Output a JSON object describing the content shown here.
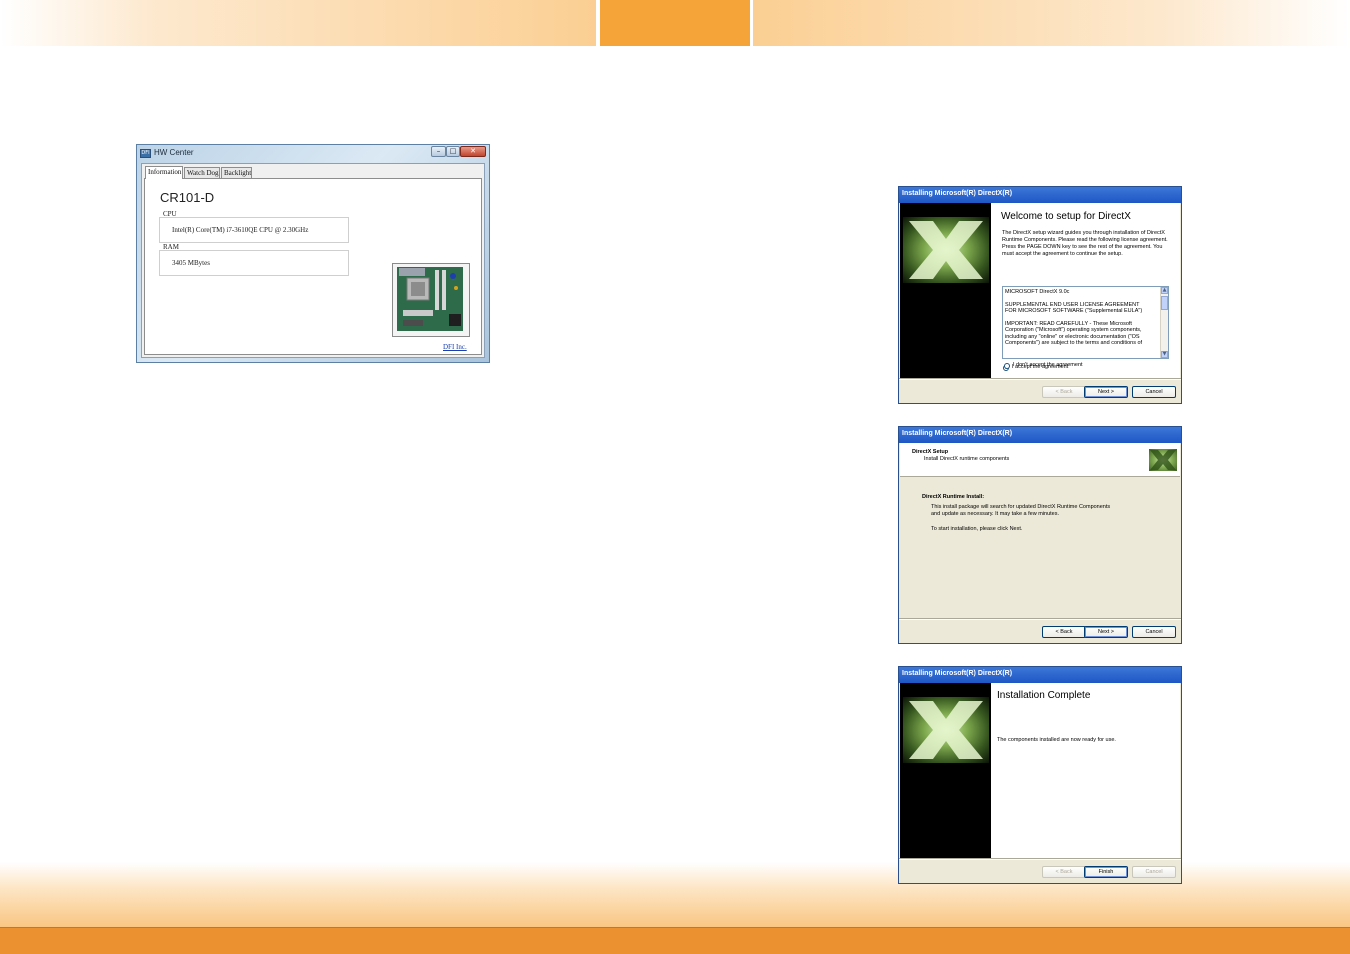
{
  "hw_center": {
    "title": "HW Center",
    "app_icon": "DFI",
    "tabs": [
      "Information",
      "Watch Dog",
      "Backlight"
    ],
    "model": "CR101-D",
    "cpu_label": "CPU",
    "cpu_value": "Intel(R) Core(TM) i7-3610QE CPU @ 2.30GHz",
    "ram_label": "RAM",
    "ram_value": "3405 MBytes",
    "board_image": "motherboard-photo",
    "link": "DFI Inc."
  },
  "directx_welcome": {
    "title": "Installing Microsoft(R) DirectX(R)",
    "heading": "Welcome to setup for DirectX",
    "intro": "The DirectX setup wizard guides you through installation of DirectX Runtime Components. Please read the following license agreement. Press the PAGE DOWN key to see the rest of the agreement. You must accept the agreement to continue the setup.",
    "license_lines": [
      "MICROSOFT DirectX 9.0c",
      "",
      "SUPPLEMENTAL END USER LICENSE AGREEMENT",
      "FOR MICROSOFT SOFTWARE (\"Supplemental EULA\")",
      "",
      "IMPORTANT: READ CAREFULLY - These Microsoft",
      "Corporation (\"Microsoft\") operating system components,",
      "including any \"online\" or electronic documentation (\"OS",
      "Components\") are subject to the terms and conditions of"
    ],
    "accept": "I accept the agreement",
    "decline": "I don't accept the agreement",
    "back": "< Back",
    "next": "Next >",
    "cancel": "Cancel"
  },
  "directx_setup": {
    "title": "Installing Microsoft(R) DirectX(R)",
    "header_title": "DirectX Setup",
    "header_sub": "Install DirectX runtime components",
    "section_title": "DirectX Runtime Install:",
    "line1": "This install package will search for updated DirectX Runtime Components",
    "line2": "and update as necessary. It may take a few minutes.",
    "line3": "To start installation, please click Next.",
    "back": "< Back",
    "next": "Next >",
    "cancel": "Cancel"
  },
  "directx_complete": {
    "title": "Installing Microsoft(R) DirectX(R)",
    "heading": "Installation Complete",
    "message": "The components installed are now ready for use.",
    "back": "< Back",
    "finish": "Finish",
    "cancel": "Cancel"
  },
  "colors": {
    "header_accent": "#f5a43a",
    "footer_bar": "#ec9130",
    "xp_title": "#1e56c4"
  }
}
